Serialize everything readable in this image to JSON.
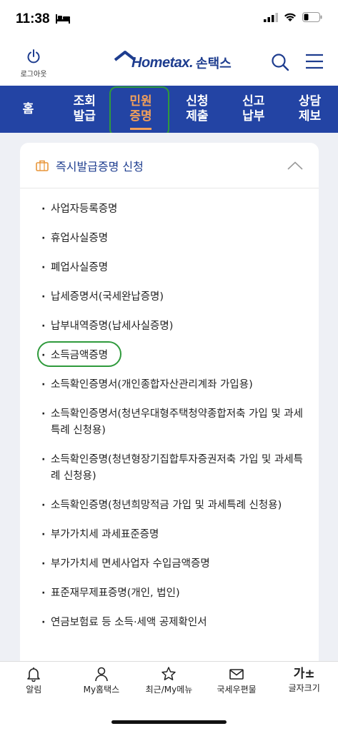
{
  "status": {
    "time": "11:38"
  },
  "header": {
    "logout_label": "로그아웃",
    "logo_main": "Hometax.",
    "logo_sub": "손택스"
  },
  "nav": {
    "items": [
      {
        "label": "홈"
      },
      {
        "label": "조회\n발급"
      },
      {
        "label": "민원\n증명"
      },
      {
        "label": "신청\n제출"
      },
      {
        "label": "신고\n납부"
      },
      {
        "label": "상담\n제보"
      }
    ],
    "active_index": 2
  },
  "section": {
    "title": "즉시발급증명 신청",
    "items": [
      "사업자등록증명",
      "휴업사실증명",
      "폐업사실증명",
      "납세증명서(국세완납증명)",
      "납부내역증명(납세사실증명)",
      "소득금액증명",
      "소득확인증명서(개인종합자산관리계좌 가입용)",
      "소득확인증명서(청년우대형주택청약종합저축 가입 및 과세특례 신청용)",
      "소득확인증명(청년형장기집합투자증권저축 가입 및 과세특례 신청용)",
      "소득확인증명(청년희망적금 가입 및 과세특례 신청용)",
      "부가가치세 과세표준증명",
      "부가가치세 면세사업자 수입금액증명",
      "표준재무제표증명(개인, 법인)",
      "연금보험료 등 소득·세액 공제확인서"
    ]
  },
  "bottom_tabs": [
    {
      "label": "알림",
      "icon": "bell-icon"
    },
    {
      "label": "My홈택스",
      "icon": "person-icon"
    },
    {
      "label": "최근/My메뉴",
      "icon": "star-icon"
    },
    {
      "label": "국세우편물",
      "icon": "mail-icon"
    },
    {
      "label": "글자크기",
      "icon": "font-size-icon",
      "icon_text": "가±"
    }
  ],
  "colors": {
    "nav_bg": "#2344a4",
    "nav_active": "#f2a05a",
    "brand": "#1e3d8f",
    "highlight": "#2f9a3c"
  }
}
